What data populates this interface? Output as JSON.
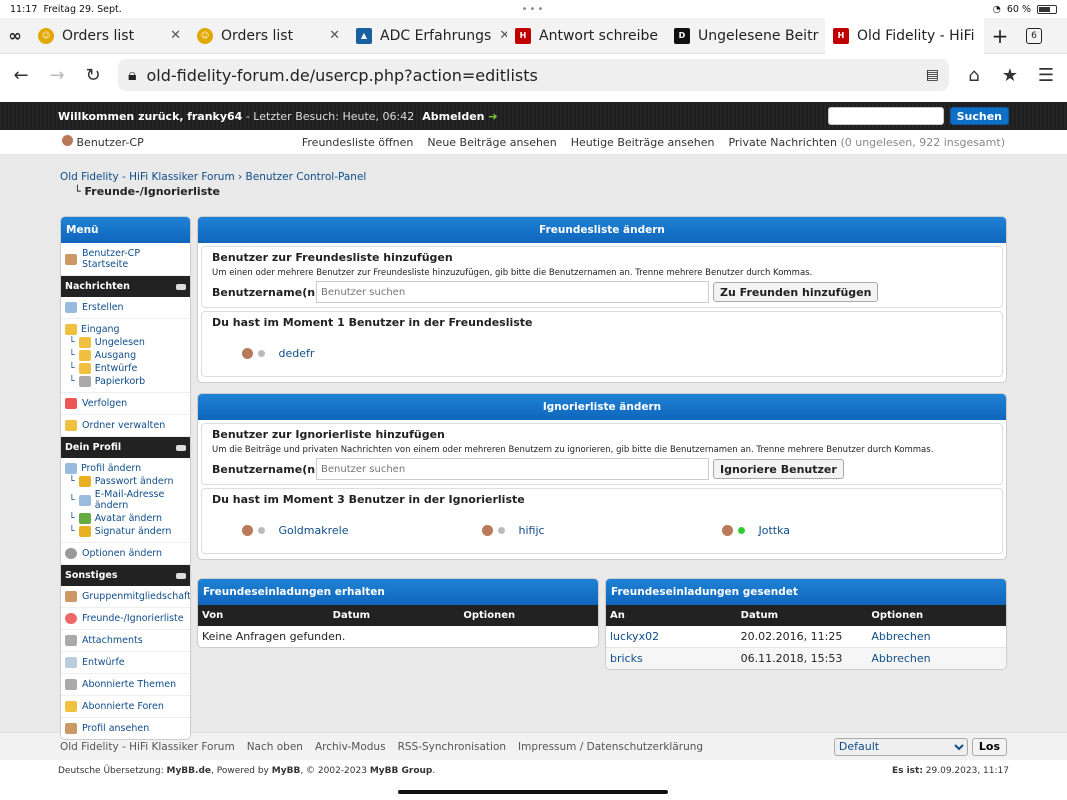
{
  "status": {
    "time": "11:17",
    "date": "Freitag 29. Sept.",
    "battery": "60 %"
  },
  "tabs": [
    {
      "label": "Orders list",
      "icon_color": "#e0a800"
    },
    {
      "label": "Orders list",
      "icon_color": "#e0a800"
    },
    {
      "label": "ADC Erfahrungs",
      "icon_color": "#1a5fa0"
    },
    {
      "label": "Antwort schreibe",
      "icon_color": "#c00000"
    },
    {
      "label": "Ungelesene Beitr",
      "icon_color": "#111111"
    },
    {
      "label": "Old Fidelity - HiFi",
      "icon_color": "#c00000"
    }
  ],
  "tab_count": "6",
  "url": "old-fidelity-forum.de/usercp.php?action=editlists",
  "header": {
    "welcome": "Willkommen zurück,",
    "user": "franky64",
    "last": "- Letzter Besuch: Heute, 06:42",
    "logout": "Abmelden",
    "search_btn": "Suchen"
  },
  "menubar": {
    "left": "Benutzer-CP",
    "items": [
      "Freundesliste öffnen",
      "Neue Beiträge ansehen",
      "Heutige Beiträge ansehen",
      "Private Nachrichten"
    ],
    "pm_counts": "(0 ungelesen, 922 insgesamt)"
  },
  "breadcrumb": {
    "path": "Old Fidelity - HiFi Klassiker Forum › Benutzer Control-Panel",
    "current": "Freunde-/Ignorierliste"
  },
  "sidebar": {
    "title": "Menü",
    "start": "Benutzer-CP Startseite",
    "cat1": "Nachrichten",
    "erstellen": "Erstellen",
    "eingang": "Eingang",
    "folders": [
      "Ungelesen",
      "Ausgang",
      "Entwürfe",
      "Papierkorb"
    ],
    "verfolgen": "Verfolgen",
    "ordner": "Ordner verwalten",
    "cat2": "Dein Profil",
    "profil": "Profil ändern",
    "profile_items": [
      "Passwort ändern",
      "E-Mail-Adresse ändern",
      "Avatar ändern",
      "Signatur ändern"
    ],
    "optionen": "Optionen ändern",
    "cat3": "Sonstiges",
    "other": [
      "Gruppenmitgliedschaften",
      "Freunde-/Ignorierliste",
      "Attachments",
      "Entwürfe",
      "Abonnierte Themen",
      "Abonnierte Foren",
      "Profil ansehen"
    ]
  },
  "friends": {
    "title": "Freundesliste ändern",
    "add_title": "Benutzer zur Freundesliste hinzufügen",
    "desc": "Um einen oder mehrere Benutzer zur Freundesliste hinzuzufügen, gib bitte die Benutzernamen an. Trenne mehrere Benutzer durch Kommas.",
    "label": "Benutzername(n)",
    "placeholder": "Benutzer suchen",
    "button": "Zu Freunden hinzufügen",
    "current": "Du hast im Moment 1 Benutzer in der Freundesliste",
    "users": [
      "dedefr"
    ]
  },
  "ignore": {
    "title": "Ignorierliste ändern",
    "add_title": "Benutzer zur Ignorierliste hinzufügen",
    "desc": "Um die Beiträge und privaten Nachrichten von einem oder mehreren Benutzern zu ignorieren, gib bitte die Benutzernamen an. Trenne mehrere Benutzer durch Kommas.",
    "label": "Benutzername(n)",
    "placeholder": "Benutzer suchen",
    "button": "Ignoriere Benutzer",
    "current": "Du hast im Moment 3 Benutzer in der Ignorierliste",
    "users": [
      "Goldmakrele",
      "hifijc",
      "Jottka"
    ]
  },
  "received": {
    "title": "Freundeseinladungen erhalten",
    "cols": [
      "Von",
      "Datum",
      "Optionen"
    ],
    "empty": "Keine Anfragen gefunden."
  },
  "sent": {
    "title": "Freundeseinladungen gesendet",
    "cols": [
      "An",
      "Datum",
      "Optionen"
    ],
    "rows": [
      {
        "to": "luckyx02",
        "date": "20.02.2016, 11:25",
        "opt": "Abbrechen"
      },
      {
        "to": "bricks",
        "date": "06.11.2018, 15:53",
        "opt": "Abbrechen"
      }
    ]
  },
  "footer": {
    "links": [
      "Old Fidelity - HiFi Klassiker Forum",
      "Nach oben",
      "Archiv-Modus",
      "RSS-Synchronisation",
      "Impressum / Datenschutzerklärung"
    ],
    "theme": "Default",
    "go": "Los"
  },
  "copyright": {
    "prefix": "Deutsche Übersetzung:",
    "mybbde": "MyBB.de",
    "powered": ", Powered by",
    "mybb": "MyBB",
    "years": ", © 2002-2023",
    "group": "MyBB Group",
    "dot": ".",
    "now_label": "Es ist:",
    "now": "29.09.2023, 11:17"
  }
}
